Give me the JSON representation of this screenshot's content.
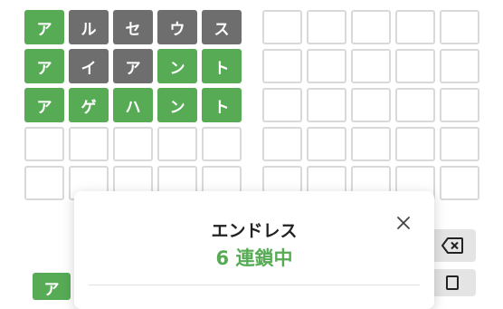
{
  "board_left": {
    "rows": [
      [
        {
          "char": "ア",
          "state": "hit"
        },
        {
          "char": "ル",
          "state": "miss"
        },
        {
          "char": "セ",
          "state": "miss"
        },
        {
          "char": "ウ",
          "state": "miss"
        },
        {
          "char": "ス",
          "state": "miss"
        }
      ],
      [
        {
          "char": "ア",
          "state": "hit"
        },
        {
          "char": "イ",
          "state": "miss"
        },
        {
          "char": "ア",
          "state": "miss"
        },
        {
          "char": "ン",
          "state": "hit"
        },
        {
          "char": "ト",
          "state": "hit"
        }
      ],
      [
        {
          "char": "ア",
          "state": "hit"
        },
        {
          "char": "ゲ",
          "state": "hit"
        },
        {
          "char": "ハ",
          "state": "hit"
        },
        {
          "char": "ン",
          "state": "hit"
        },
        {
          "char": "ト",
          "state": "hit"
        }
      ],
      [
        {
          "char": "",
          "state": "empty"
        },
        {
          "char": "",
          "state": "empty"
        },
        {
          "char": "",
          "state": "empty"
        },
        {
          "char": "",
          "state": "empty"
        },
        {
          "char": "",
          "state": "empty"
        }
      ],
      [
        {
          "char": "",
          "state": "empty"
        },
        {
          "char": "",
          "state": "empty"
        },
        {
          "char": "",
          "state": "empty"
        },
        {
          "char": "",
          "state": "empty"
        },
        {
          "char": "",
          "state": "empty"
        }
      ]
    ]
  },
  "board_right": {
    "rows": [
      [
        {
          "char": "",
          "state": "empty"
        },
        {
          "char": "",
          "state": "empty"
        },
        {
          "char": "",
          "state": "empty"
        },
        {
          "char": "",
          "state": "empty"
        },
        {
          "char": "",
          "state": "empty"
        }
      ],
      [
        {
          "char": "",
          "state": "empty"
        },
        {
          "char": "",
          "state": "empty"
        },
        {
          "char": "",
          "state": "empty"
        },
        {
          "char": "",
          "state": "empty"
        },
        {
          "char": "",
          "state": "empty"
        }
      ],
      [
        {
          "char": "",
          "state": "empty"
        },
        {
          "char": "",
          "state": "empty"
        },
        {
          "char": "",
          "state": "empty"
        },
        {
          "char": "",
          "state": "empty"
        },
        {
          "char": "",
          "state": "empty"
        }
      ],
      [
        {
          "char": "",
          "state": "empty"
        },
        {
          "char": "",
          "state": "empty"
        },
        {
          "char": "",
          "state": "empty"
        },
        {
          "char": "",
          "state": "empty"
        },
        {
          "char": "",
          "state": "empty"
        }
      ],
      [
        {
          "char": "",
          "state": "empty"
        },
        {
          "char": "",
          "state": "empty"
        },
        {
          "char": "",
          "state": "empty"
        },
        {
          "char": "",
          "state": "empty"
        },
        {
          "char": "",
          "state": "empty"
        }
      ]
    ]
  },
  "keyboard": {
    "partial_key_label": "ア",
    "backspace_icon": "backspace-icon",
    "enter_icon": "enter-icon"
  },
  "modal": {
    "title": "エンドレス",
    "streak": "6 連鎖中",
    "close_icon": "close-icon"
  },
  "colors": {
    "hit": "#57ab55",
    "miss": "#6e6e6e",
    "empty_border": "#d9d9d9",
    "streak_text": "#57ab55"
  }
}
